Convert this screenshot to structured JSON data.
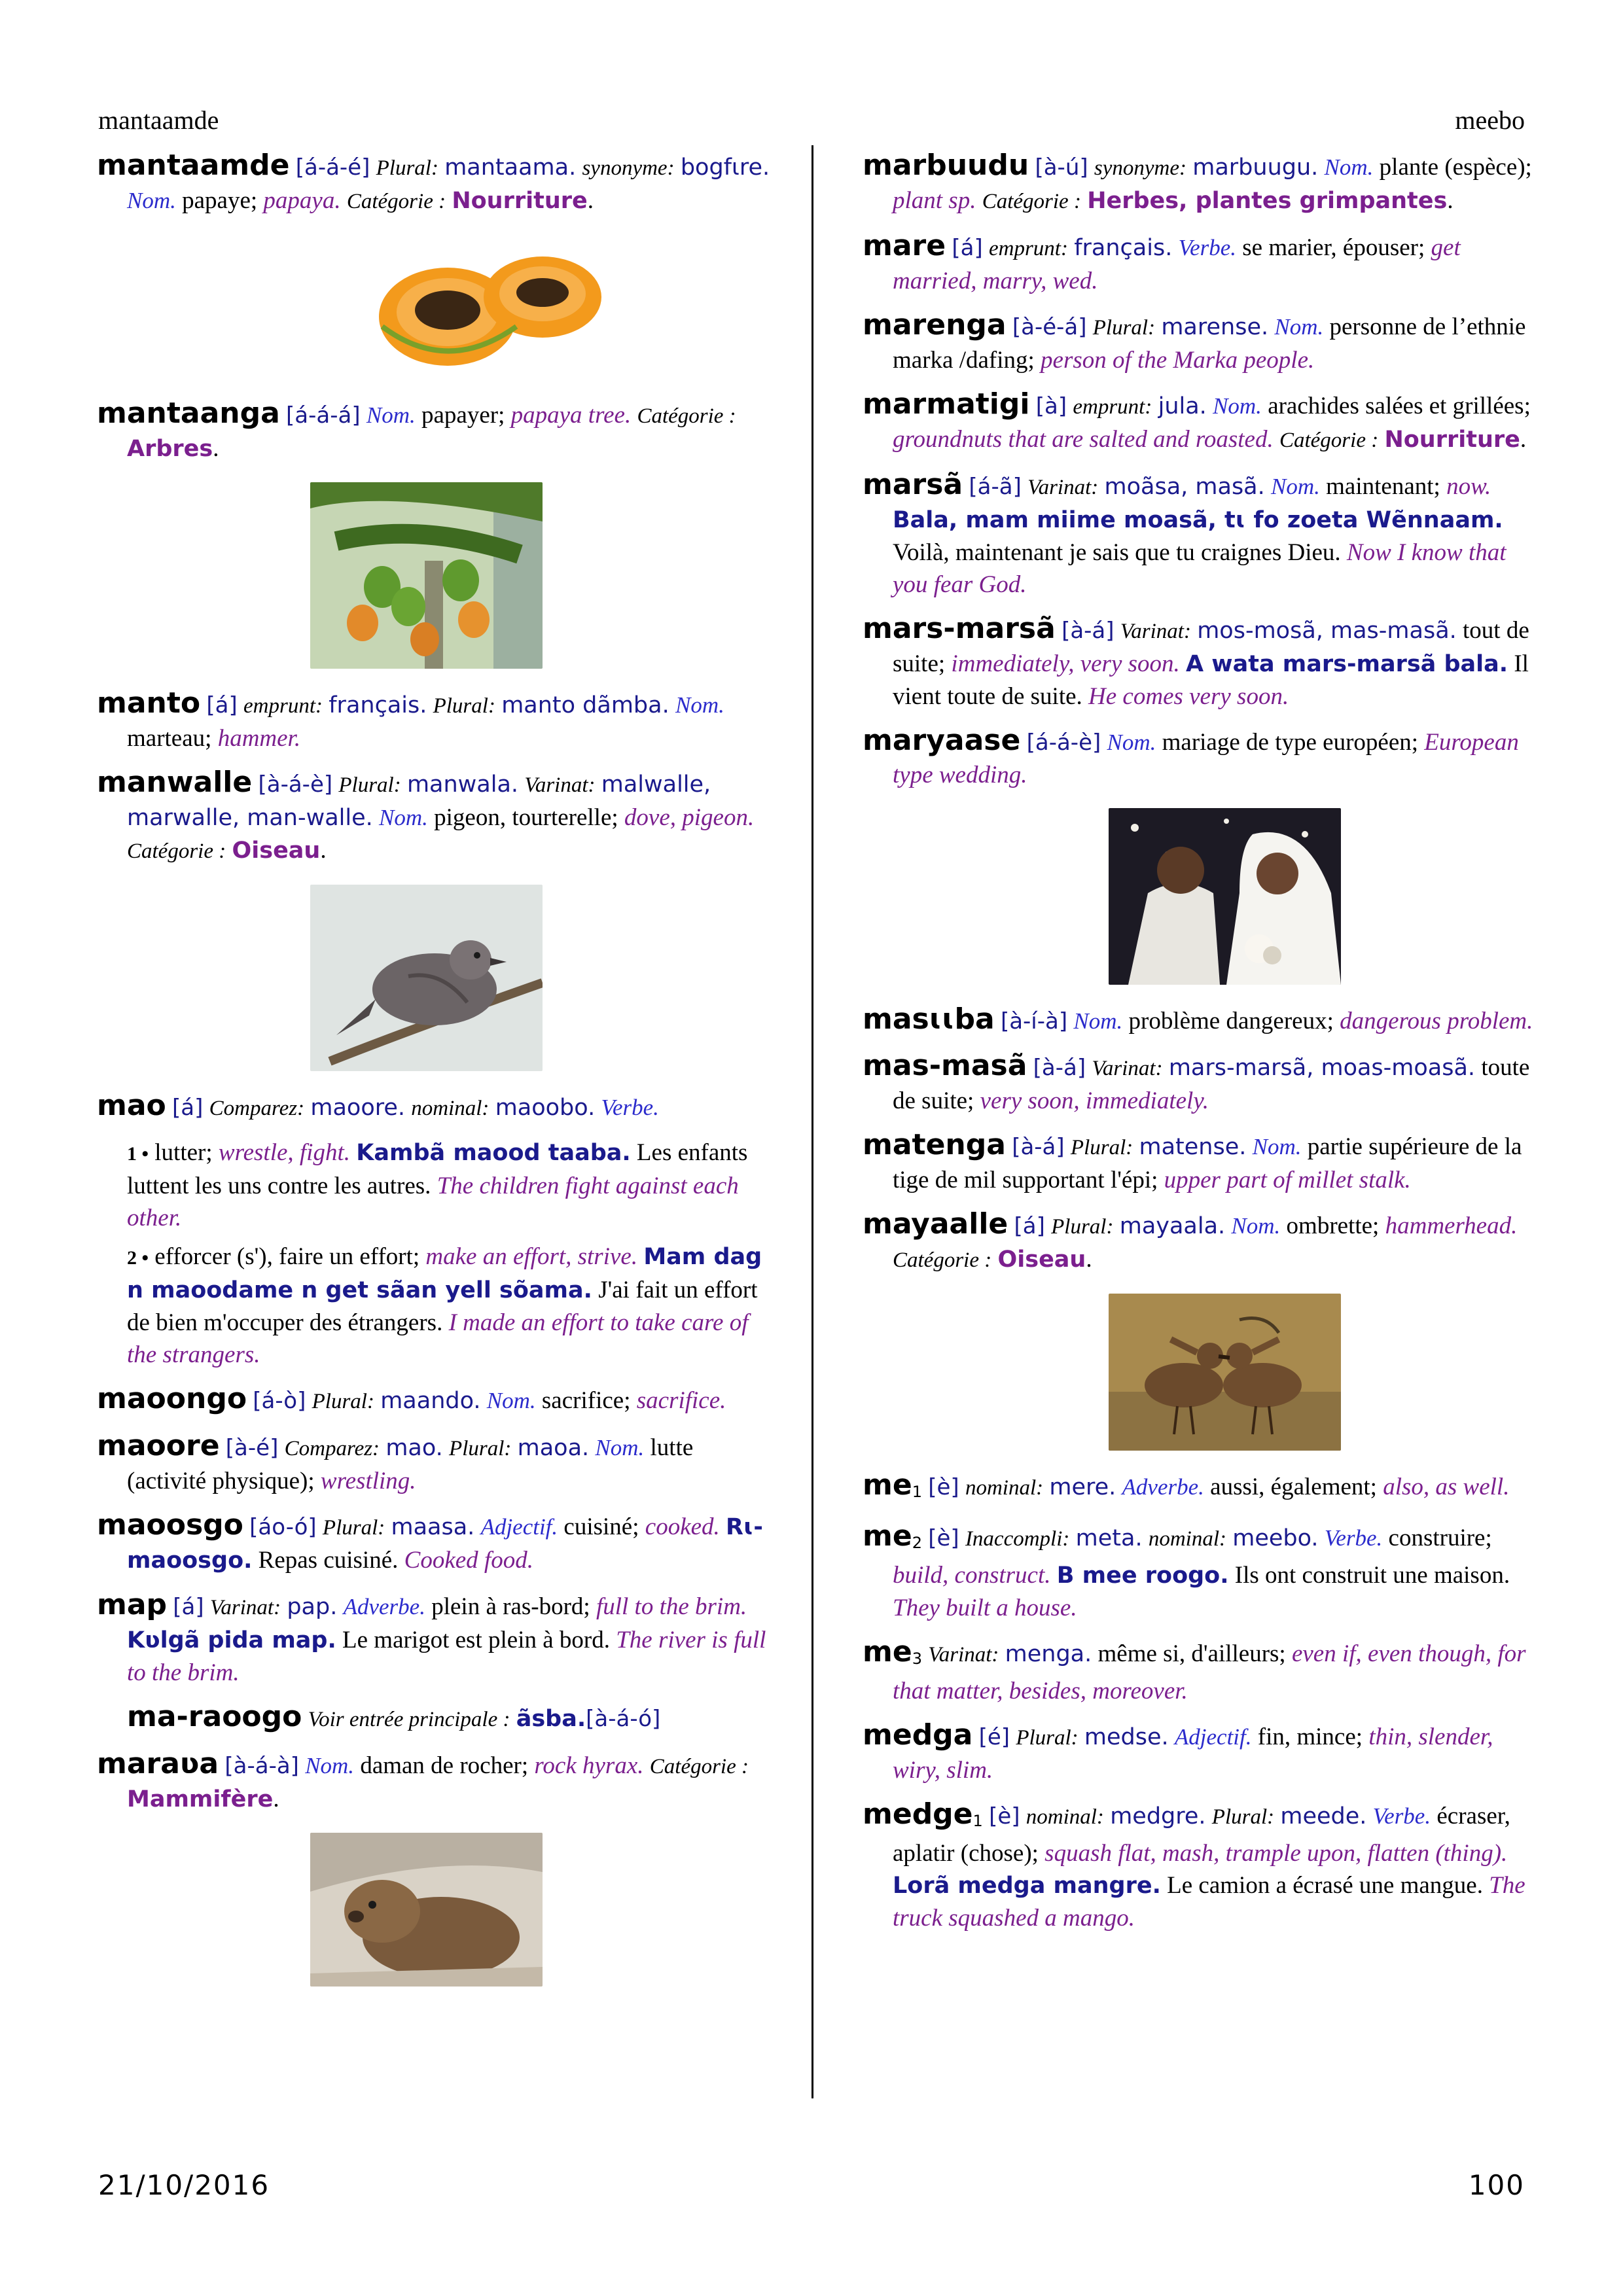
{
  "header": {
    "left": "mantaamde",
    "right": "meebo"
  },
  "footer": {
    "date": "21/10/2016",
    "page": "100"
  },
  "labels": {
    "plural": "Plural:",
    "synonyme": "synonyme:",
    "nom": "Nom.",
    "verbe": "Verbe.",
    "adverbe": "Adverbe.",
    "adjectif": "Adjectif.",
    "categorie": "Catégorie :",
    "emprunt": "emprunt:",
    "variant": "Varinat:",
    "comparez": "Comparez:",
    "nominal": "nominal:",
    "voir": "Voir entrée principale :",
    "inaccompli": "Inaccompli:",
    "item1": "1 •",
    "item2": "2 •"
  },
  "left": {
    "mantaamde": {
      "hw": "mantaamde",
      "ph": "[á-á-é]",
      "plural": "mantaama.",
      "syn": "bogfɩre.",
      "fr": "papaye;",
      "en": "papaya.",
      "cat": "Nourriture"
    },
    "mantaanga": {
      "hw": "mantaanga",
      "ph": "[á-á-á]",
      "fr": "papayer;",
      "en": "papaya tree.",
      "cat": "Arbres"
    },
    "manto": {
      "hw": "manto",
      "ph": "[á]",
      "emprunt": "français.",
      "plural": "manto dãmba.",
      "fr": "marteau;",
      "en": "hammer."
    },
    "manwalle": {
      "hw": "manwalle",
      "ph": "[à-á-è]",
      "plural": "manwala.",
      "variant": "malwalle, marwalle, man-walle.",
      "fr": "pigeon, tourterelle;",
      "en": "dove, pigeon.",
      "cat": "Oiseau"
    },
    "mao": {
      "hw": "mao",
      "ph": "[á]",
      "comparez": "maoore.",
      "nominal": "maoobo.",
      "s1_fr": "lutter;",
      "s1_en": "wrestle, fight.",
      "s1_ex": "Kambã maood taaba.",
      "s1_exfr": "Les enfants luttent les uns contre les autres.",
      "s1_exen": "The children fight against each other.",
      "s2_fr": "efforcer (s'), faire un effort;",
      "s2_en": "make an effort, strive.",
      "s2_ex": "Mam dag n maoodame n get sãan yell sõama.",
      "s2_exfr": "J'ai fait un effort de bien m'occuper des étrangers.",
      "s2_exen": "I made an effort to take care of the strangers."
    },
    "maoongo": {
      "hw": "maoongo",
      "ph": "[á-ò]",
      "plural": "maando.",
      "fr": "sacrifice;",
      "en": "sacrifice."
    },
    "maoore": {
      "hw": "maoore",
      "ph": "[à-é]",
      "comparez": "mao.",
      "plural": "maoa.",
      "fr": "lutte (activité physique);",
      "en": "wrestling."
    },
    "maoosgo": {
      "hw": "maoosgo",
      "ph": "[áo-ó]",
      "plural": "maasa.",
      "fr": "cuisiné;",
      "en": "cooked.",
      "ex": "Rɩ-maoosgo.",
      "exfr": "Repas cuisiné.",
      "exen": "Cooked food."
    },
    "map": {
      "hw": "map",
      "ph": "[á]",
      "variant": "pap.",
      "fr": "plein à ras-bord;",
      "en": "full to the brim.",
      "ex": "Kʋlgã pida map.",
      "exfr": "Le marigot est plein à bord.",
      "exen": "The river is full to the brim."
    },
    "maraoogo": {
      "hw": "ma-raoogo",
      "ref": "ãsba.",
      "ph": "[à-á-ó]"
    },
    "marava": {
      "hw": "maraʋa",
      "ph": "[à-á-à]",
      "fr": "daman de rocher;",
      "en": "rock hyrax.",
      "cat": "Mammifère"
    }
  },
  "right": {
    "marbuudu": {
      "hw": "marbuudu",
      "ph": "[à-ú]",
      "syn": "marbuugu.",
      "fr": "plante (espèce);",
      "en": "plant sp.",
      "cat": "Herbes, plantes grimpantes"
    },
    "mare": {
      "hw": "mare",
      "ph": "[á]",
      "emprunt": "français.",
      "fr": "se marier, épouser;",
      "en": "get married, marry, wed."
    },
    "marenga": {
      "hw": "marenga",
      "ph": "[à-é-á]",
      "plural": "marense.",
      "fr": "personne de l’ethnie marka /dafing;",
      "en": "person of the Marka people."
    },
    "marmatigi": {
      "hw": "marmatigi",
      "ph": "[à]",
      "emprunt": "jula.",
      "fr": "arachides salées et grillées;",
      "en": "groundnuts that are salted and roasted.",
      "cat": "Nourriture"
    },
    "marsa": {
      "hw": "marsã",
      "ph": "[á-ã]",
      "variant": "moãsa, masã.",
      "fr": "maintenant;",
      "en": "now.",
      "ex": "Bala, mam miime moasã, tɩ fo zoeta Wẽnnaam.",
      "exfr": "Voilà, maintenant je sais que tu craignes Dieu.",
      "exen": "Now I know that you fear God."
    },
    "marsmarsa": {
      "hw": "mars-marsã",
      "ph": "[à-á]",
      "variant": "mos-mosã, mas-masã.",
      "fr": "tout de suite;",
      "en": "immediately, very soon.",
      "ex": "A wata mars-marsã bala.",
      "exfr": "Il vient toute de suite.",
      "exen": "He comes very soon."
    },
    "maryaase": {
      "hw": "maryaase",
      "ph": "[á-á-è]",
      "fr": "mariage de type européen;",
      "en": "European type wedding."
    },
    "masuuba": {
      "hw": "masɩɩba",
      "ph": "[à-í-à]",
      "fr": "problème dangereux;",
      "en": "dangerous problem."
    },
    "masmasa": {
      "hw": "mas-masã",
      "ph": "[à-á]",
      "variant": "mars-marsã, moas-moasã.",
      "fr": "toute de suite;",
      "en": "very soon, immediately."
    },
    "matenga": {
      "hw": "matenga",
      "ph": "[à-á]",
      "plural": "matense.",
      "fr": "partie supérieure de la tige de mil supportant l'épi;",
      "en": "upper part of millet stalk."
    },
    "mayaalle": {
      "hw": "mayaalle",
      "ph": "[á]",
      "plural": "mayaala.",
      "fr": "ombrette;",
      "en": "hammerhead.",
      "cat": "Oiseau"
    },
    "me1": {
      "hw": "me",
      "hom": "1",
      "ph": "[è]",
      "nominal": "mere.",
      "fr": "aussi, également;",
      "en": "also, as well."
    },
    "me2": {
      "hw": "me",
      "hom": "2",
      "ph": "[è]",
      "inacc": "meta.",
      "nominal": "meebo.",
      "fr": "construire;",
      "en": "build, construct.",
      "ex": "B mee roogo.",
      "exfr": "Ils ont construit une maison.",
      "exen": "They built a house."
    },
    "me3": {
      "hw": "me",
      "hom": "3",
      "variant": "menga.",
      "fr": "même si, d'ailleurs;",
      "en": "even if, even though, for that matter, besides, moreover."
    },
    "medga": {
      "hw": "medga",
      "ph": "[é]",
      "plural": "medse.",
      "fr": "fin, mince;",
      "en": "thin, slender, wiry, slim."
    },
    "medge1": {
      "hw": "medge",
      "hom": "1",
      "ph": "[è]",
      "nominal": "medgre.",
      "plural": "meede.",
      "fr": "écraser, aplatir (chose);",
      "en": "squash flat, mash, trample upon, flatten (thing).",
      "ex": "Lorã medga mangre.",
      "exfr": "Le camion a écrasé une mangue.",
      "exen": "The truck squashed a mango."
    }
  },
  "colors": {
    "vernacular": "#1a1a8c",
    "pos": "#2b2bcc",
    "english": "#7b1f8e",
    "category": "#7b1f8e"
  }
}
